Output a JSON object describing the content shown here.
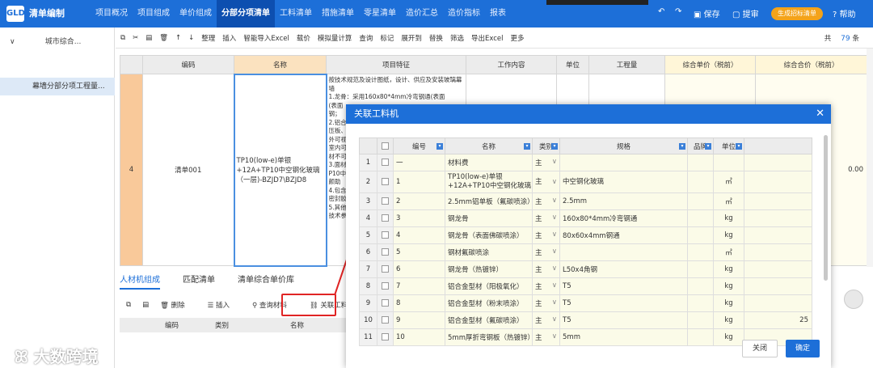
{
  "app": {
    "title": "清单编制",
    "logo": "GLD"
  },
  "nav": [
    "项目概况",
    "项目组成",
    "单价组成",
    "分部分项清单",
    "工料清单",
    "措施清单",
    "零星清单",
    "造价汇总",
    "造价指标",
    "报表"
  ],
  "nav_active": "分部分项清单",
  "topright": {
    "save": "保存",
    "submit": "提审",
    "badge": "生成招标清单",
    "help": "帮助"
  },
  "sidebar": {
    "group": "城市综合...",
    "item": "幕墙分部分项工程量..."
  },
  "toolbar": [
    "整理",
    "插入",
    "智能导入Excel",
    "载价",
    "模拟量计算",
    "查询",
    "标记",
    "展开到",
    "替换",
    "筛选",
    "导出Excel",
    "更多"
  ],
  "total": {
    "prefix": "共",
    "count": "79",
    "suffix": "条"
  },
  "grid": {
    "headers": [
      "编码",
      "名称",
      "项目特征",
      "工作内容",
      "单位",
      "工程量",
      "综合单价（税前）",
      "综合合价（税前）"
    ],
    "row": {
      "index": "4",
      "code": "清单001",
      "name": "TP10(low-e)单银+12A+TP10中空钢化玻璃（一层)-BZJD7\\BZJD8",
      "feature": "按技术规范及设计图纸，设计、供应及安装玻璃幕墙\n1.龙骨：采用160x80*4mm冷弯钢通(表面\n(表面\n钢；\n2.铝合\n压板、\n外可视\n室内可\n材不可\n3.面材\nP10中\n颜助\n4.包含\n密封胶\n5.其他\n技术参",
      "total": "0.00"
    }
  },
  "tabs": [
    "人材机组成",
    "匹配清单",
    "清单综合单价库"
  ],
  "tab_active": "人材机组成",
  "subtool": [
    "删除",
    "插入",
    "查询材料",
    "关联工料机"
  ],
  "subhead": [
    "编码",
    "类别",
    "名称"
  ],
  "watermark": "大数跨境",
  "dialog": {
    "title": "关联工料机",
    "headers": [
      "编号",
      "名称",
      "类别",
      "规格",
      "品牌",
      "单位"
    ],
    "rows": [
      {
        "n": "1",
        "code": "一",
        "name": "材料费",
        "cat": "主",
        "spec": "",
        "unit": ""
      },
      {
        "n": "2",
        "code": "1",
        "name": "TP10(low-e)单银+12A+TP10中空钢化玻璃",
        "cat": "主",
        "spec": "中空钢化玻璃",
        "unit": "㎡"
      },
      {
        "n": "3",
        "code": "2",
        "name": "2.5mm铝单板（氟碳喷涂）",
        "cat": "主",
        "spec": "2.5mm",
        "unit": "㎡"
      },
      {
        "n": "4",
        "code": "3",
        "name": "钢龙骨",
        "cat": "主",
        "spec": "160x80*4mm冷弯钢通",
        "unit": "kg"
      },
      {
        "n": "5",
        "code": "4",
        "name": "钢龙骨（表面佛碳喷涂）",
        "cat": "主",
        "spec": "80x60x4mm钢通",
        "unit": "kg"
      },
      {
        "n": "6",
        "code": "5",
        "name": "钢材氟碳喷涂",
        "cat": "主",
        "spec": "",
        "unit": "㎡"
      },
      {
        "n": "7",
        "code": "6",
        "name": "钢龙骨（热镀锌）",
        "cat": "主",
        "spec": "L50x4角钢",
        "unit": "kg"
      },
      {
        "n": "8",
        "code": "7",
        "name": "铝合金型材（阳极氧化）",
        "cat": "主",
        "spec": "T5",
        "unit": "kg"
      },
      {
        "n": "9",
        "code": "8",
        "name": "铝合金型材（粉末喷涂）",
        "cat": "主",
        "spec": "T5",
        "unit": "kg"
      },
      {
        "n": "10",
        "code": "9",
        "name": "铝合金型材（氟碳喷涂）",
        "cat": "主",
        "spec": "T5",
        "unit": "kg",
        "extra": "25"
      },
      {
        "n": "11",
        "code": "10",
        "name": "5mm厚折弯钢板（热镀锌）",
        "cat": "主",
        "spec": "5mm",
        "unit": "kg"
      }
    ],
    "close_label": "关闭",
    "ok_label": "确定"
  },
  "colors": {
    "primary": "#1d6fd8",
    "accent": "#f4a31a",
    "highlight": "#e02424"
  }
}
